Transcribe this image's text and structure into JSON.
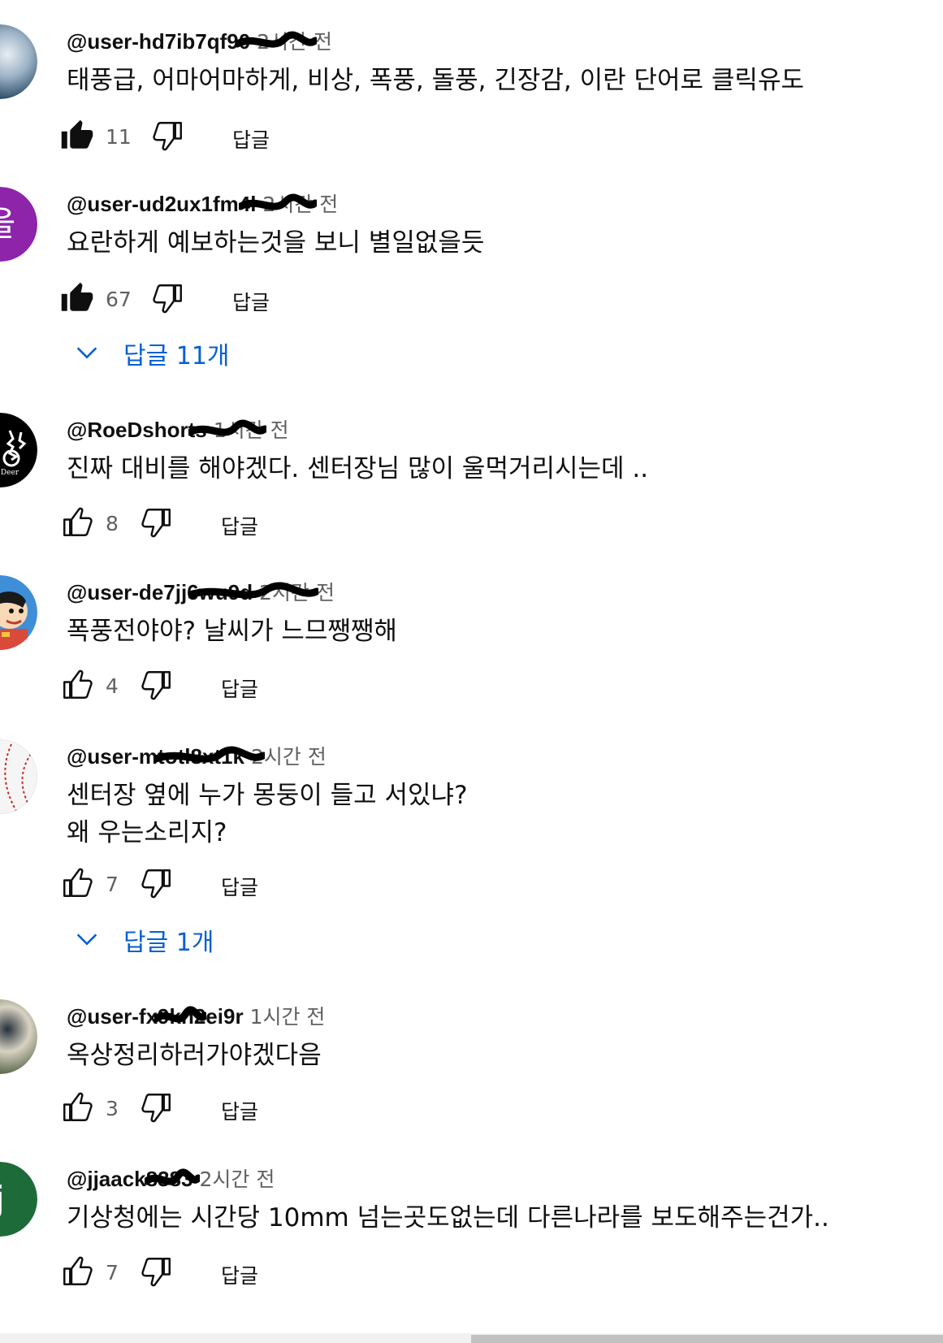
{
  "comments": [
    {
      "author": "@user-hd7ib7qf90",
      "time": "2시간 전",
      "lines": [
        "태풍급, 어마어마하게, 비상, 폭풍, 돌풍, 긴장감, 이란 단어로 클릭유도"
      ],
      "likes": "11",
      "reply_label": "답글",
      "liked": true,
      "avatar": {
        "kind": "photo",
        "colors": [
          "#2f4e6b",
          "#9db3c6",
          "#e7eef3"
        ]
      }
    },
    {
      "author": "@user-ud2ux1fm4l",
      "time": "2시간 전",
      "lines": [
        "요란하게  예보하는것을  보니   별일없을듯"
      ],
      "likes": "67",
      "reply_label": "답글",
      "liked": true,
      "replies_toggle": "답글 11개",
      "avatar": {
        "kind": "letter",
        "letter": "을",
        "color": "#8e24aa"
      }
    },
    {
      "author": "@RoeDshorts",
      "time": "1시간 전",
      "lines": [
        "진짜 대비를 해야겠다. 센터장님 많이 울먹거리시는데 .."
      ],
      "likes": "8",
      "reply_label": "답글",
      "liked": false,
      "avatar": {
        "kind": "logo",
        "logo_text": "Deer",
        "color": "#000000"
      }
    },
    {
      "author": "@user-de7jj6wu9d",
      "time": "2시간 전",
      "lines": [
        "폭풍전야야? 날씨가 느므쨍쨍해"
      ],
      "likes": "4",
      "reply_label": "답글",
      "liked": false,
      "avatar": {
        "kind": "cartoon",
        "colors": [
          "#3f8fd8",
          "#f4c542",
          "#d94a3a"
        ]
      }
    },
    {
      "author": "@user-mtotl8xt1k",
      "time": "2시간 전",
      "lines": [
        "센터장 옆에 누가 몽둥이 들고 서있냐?",
        "왜 우는소리지?"
      ],
      "likes": "7",
      "reply_label": "답글",
      "liked": false,
      "replies_toggle": "답글 1개",
      "avatar": {
        "kind": "baseball",
        "colors": [
          "#f5f5f5",
          "#c62828"
        ]
      }
    },
    {
      "author": "@user-fx9kn2ei9r",
      "time": "1시간 전",
      "lines": [
        "옥상정리하러가야겠다음"
      ],
      "likes": "3",
      "reply_label": "답글",
      "liked": false,
      "avatar": {
        "kind": "photo",
        "colors": [
          "#5d6b4f",
          "#d8d2c2",
          "#26313b"
        ]
      }
    },
    {
      "author": "@jjaack8383",
      "time": "2시간 전",
      "lines": [
        "기상청에는 시간당 10mm 넘는곳도없는데 다른나라를 보도해주는건가.."
      ],
      "likes": "7",
      "reply_label": "답글",
      "liked": false,
      "avatar": {
        "kind": "letter",
        "letter": "j",
        "color": "#1e6b3a"
      }
    }
  ],
  "icons": {
    "like": "thumbs-up-icon",
    "dislike": "thumbs-down-icon",
    "expand": "chevron-down-icon"
  },
  "colors": {
    "link": "#065fd4",
    "secondary_text": "#606060",
    "primary_text": "#0f0f0f"
  }
}
